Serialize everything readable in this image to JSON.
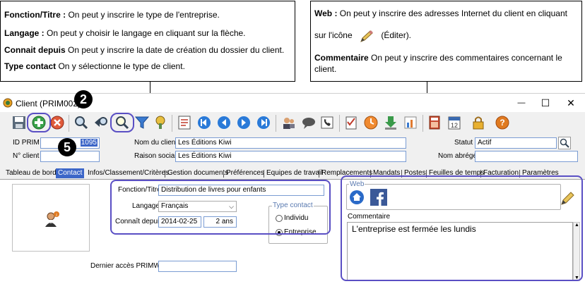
{
  "callouts": {
    "left": [
      {
        "term": "Fonction/Titre :",
        "desc": " On peut y inscrire le type de l'entreprise."
      },
      {
        "term": "Langage :",
        "desc": " On peut y choisir le langage en cliquant sur la flèche."
      },
      {
        "term": "Connait depuis",
        "desc": "   On peut y inscrire la date de création du dossier du client."
      },
      {
        "term": "Type contact",
        "desc": "   On y sélectionne le type de client."
      }
    ],
    "right": {
      "web_term": "Web :",
      "web_desc_1": " On peut y inscrire des adresses Internet du client en cliquant",
      "web_desc_2": "sur l'icône",
      "web_desc_3": "(Éditer).",
      "comment_term": "Commentaire",
      "comment_desc_1": "   On peut y inscrire des commentaires concernant le",
      "comment_desc_2": "client."
    }
  },
  "badges": {
    "two": "2",
    "five": "5"
  },
  "window": {
    "title": "Client (PRIM002)",
    "controls": {
      "minimize": "—",
      "maximize": "☐",
      "close": "✕"
    }
  },
  "header": {
    "id_prim_label": "ID PRIM",
    "id_prim_value": "1095",
    "no_client_label": "N° client",
    "no_client_value": "",
    "nom_client_label": "Nom du client",
    "nom_client_value": "Les Éditions Kiwi",
    "raison_sociale_label": "Raison sociale",
    "raison_sociale_value": "Les Éditions Kiwi",
    "statut_label": "Statut",
    "statut_value": "Actif",
    "nom_abrege_label": "Nom abrégé",
    "nom_abrege_value": ""
  },
  "tabs": [
    "Tableau de bord",
    "Contact",
    "Infos/Classement/Critères",
    "Gestion documents",
    "Préférences",
    "Equipes de travail",
    "Remplacements",
    "Mandats",
    "Postes",
    "Feuilles de temps",
    "Facturation",
    "Paramètres"
  ],
  "contact": {
    "fonction_label": "Fonction/Titre",
    "fonction_value": "Distribution de livres pour enfants",
    "langage_label": "Langage",
    "langage_value": "Français",
    "connait_label": "Connaît depuis",
    "connait_date": "2014-02-25",
    "connait_years": "2 ans",
    "type_contact_label": "Type contact",
    "type_options": [
      "Individu",
      "Entreprise"
    ],
    "type_selected": "Entreprise",
    "dernier_acces_label": "Dernier accès PRIMWeb",
    "dernier_acces_value": ""
  },
  "web": {
    "label": "Web",
    "commentaire_label": "Commentaire",
    "commentaire_value": "L'entreprise est fermée les lundis"
  },
  "colors": {
    "accent": "#5a4fc4",
    "tab_active": "#3c66c8",
    "field_border": "#7a9cd3"
  }
}
